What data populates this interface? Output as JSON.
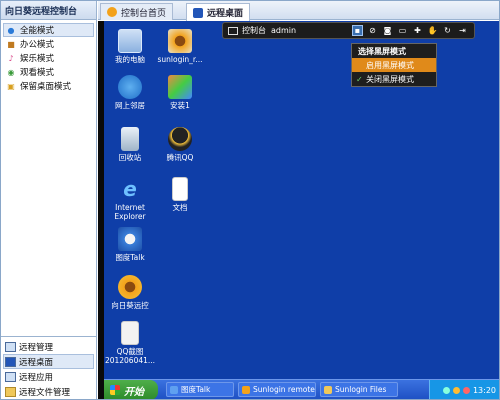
{
  "left_panel": {
    "title": "向日葵远程控制台",
    "modes": [
      {
        "label": "全能模式",
        "icon": "globe-icon",
        "color": "#2a7ad8",
        "selected": true
      },
      {
        "label": "办公模式",
        "icon": "briefcase-icon",
        "color": "#c07a20",
        "selected": false
      },
      {
        "label": "娱乐模式",
        "icon": "music-icon",
        "color": "#d84a8a",
        "selected": false
      },
      {
        "label": "观看模式",
        "icon": "eye-icon",
        "color": "#3a9a3a",
        "selected": false
      },
      {
        "label": "保留桌面模式",
        "icon": "desktop-icon",
        "color": "#d8a020",
        "selected": false
      }
    ],
    "nav": [
      {
        "label": "远程管理",
        "icon": "monitor-icon",
        "selected": false
      },
      {
        "label": "远程桌面",
        "icon": "remote-desktop-icon",
        "selected": true
      },
      {
        "label": "远程应用",
        "icon": "application-icon",
        "selected": false
      },
      {
        "label": "远程文件管理",
        "icon": "folder-icon",
        "selected": false
      }
    ]
  },
  "tabs": [
    {
      "label": "控制台首页",
      "icon": "sunflower-icon",
      "active": false
    },
    {
      "label": "远程桌面",
      "icon": "remote-desktop-icon",
      "active": true
    }
  ],
  "control_bar": {
    "label": "控制台",
    "user": "admin",
    "buttons": [
      "screen-icon",
      "link-icon",
      "camera-icon",
      "window-icon",
      "plus-icon",
      "hand-icon",
      "refresh-icon",
      "exit-icon"
    ]
  },
  "dropdown": {
    "title": "选择黑屏模式",
    "items": [
      {
        "label": "启用黑屏模式",
        "checked": false,
        "highlighted": true
      },
      {
        "label": "关闭黑屏模式",
        "checked": true,
        "highlighted": false
      }
    ]
  },
  "desktop_icons": {
    "my_computer": "我的电脑",
    "sunlogin": "sunlogin_r...",
    "network": "网上邻居",
    "install": "安装1",
    "recycle": "回收站",
    "qq": "腾讯QQ",
    "ie_line1": "Internet",
    "ie_line2": "Explorer",
    "docs": "文档",
    "talk": "图度Talk",
    "sunflower": "向日葵远控",
    "screenshot_line1": "QQ截图",
    "screenshot_line2": "201206041..."
  },
  "taskbar": {
    "start": "开始",
    "tasks": [
      "图度Talk",
      "Sunlogin remote",
      "Sunlogin Files"
    ],
    "clock": "13:20"
  }
}
